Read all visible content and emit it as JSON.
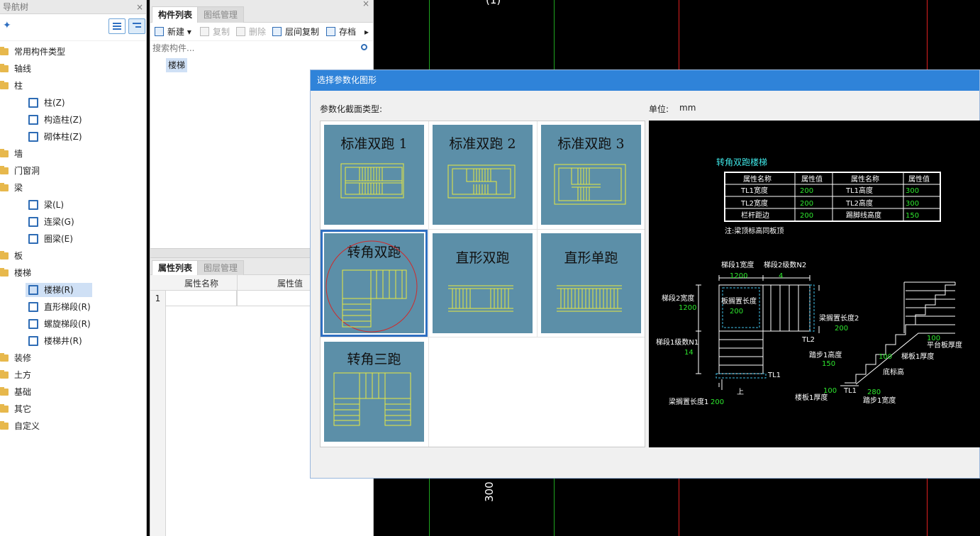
{
  "nav": {
    "title": "导航树",
    "close": "×",
    "items": [
      {
        "label": "常用构件类型",
        "level": 0
      },
      {
        "label": "轴线",
        "level": 0
      },
      {
        "label": "柱",
        "level": 0
      },
      {
        "label": "柱(Z)",
        "level": 1
      },
      {
        "label": "构造柱(Z)",
        "level": 1
      },
      {
        "label": "砌体柱(Z)",
        "level": 1
      },
      {
        "label": "墙",
        "level": 0
      },
      {
        "label": "门窗洞",
        "level": 0
      },
      {
        "label": "梁",
        "level": 0
      },
      {
        "label": "梁(L)",
        "level": 1
      },
      {
        "label": "连梁(G)",
        "level": 1
      },
      {
        "label": "圈梁(E)",
        "level": 1
      },
      {
        "label": "板",
        "level": 0
      },
      {
        "label": "楼梯",
        "level": 0
      },
      {
        "label": "楼梯(R)",
        "level": 1,
        "selected": true
      },
      {
        "label": "直形梯段(R)",
        "level": 1
      },
      {
        "label": "螺旋梯段(R)",
        "level": 1
      },
      {
        "label": "楼梯井(R)",
        "level": 1
      },
      {
        "label": "装修",
        "level": 0
      },
      {
        "label": "土方",
        "level": 0
      },
      {
        "label": "基础",
        "level": 0
      },
      {
        "label": "其它",
        "level": 0
      },
      {
        "label": "自定义",
        "level": 0
      }
    ]
  },
  "components": {
    "tab_list": "构件列表",
    "tab_drawings": "图纸管理",
    "close": "×",
    "toolbar": {
      "new": "新建",
      "copy": "复制",
      "delete": "删除",
      "floor_copy": "层间复制",
      "save": "存档",
      "more": "▸"
    },
    "search_placeholder": "搜索构件...",
    "item": "楼梯"
  },
  "properties": {
    "tab_props": "属性列表",
    "tab_layers": "图层管理",
    "col_name": "属性名称",
    "col_value": "属性值",
    "row_num": "1"
  },
  "canvas": {
    "top_label": "(1)",
    "dim_label": "300",
    "colors": {
      "green": "#1fa51f",
      "red": "#e02020",
      "white": "#ffffff"
    }
  },
  "dialog": {
    "title": "选择参数化图形",
    "section_label": "参数化截面类型:",
    "unit_label": "单位:",
    "unit_value": "mm",
    "tiles": [
      {
        "label": "标准双跑 1"
      },
      {
        "label": "标准双跑 2"
      },
      {
        "label": "标准双跑 3"
      },
      {
        "label": "转角双跑",
        "selected": true
      },
      {
        "label": "直形双跑"
      },
      {
        "label": "直形单跑"
      },
      {
        "label": "转角三跑"
      }
    ],
    "preview": {
      "title": "转角双跑楼梯",
      "table_headers": [
        "属性名称",
        "属性值",
        "属性名称",
        "属性值"
      ],
      "table_rows": [
        [
          "TL1宽度",
          "200",
          "TL1高度",
          "300"
        ],
        [
          "TL2宽度",
          "200",
          "TL2高度",
          "300"
        ],
        [
          "栏杆距边",
          "200",
          "踢脚线高度",
          "150"
        ]
      ],
      "note": "注:梁顶标高同板顶",
      "labels": {
        "seg1_width": "梯段1宽度",
        "seg1_width_val": "1200",
        "seg2_steps": "梯段2级数N2",
        "seg2_steps_val": "4",
        "seg2_width": "梯段2宽度",
        "seg2_width_val": "1200",
        "slab_len": "板搁置长度",
        "slab_len_val": "200",
        "beam_len2": "梁搁置长度2",
        "beam_len2_val": "200",
        "tl2": "TL2",
        "seg1_steps": "梯段1级数N1",
        "seg1_steps_val": "14",
        "tl1": "TL1",
        "up": "上",
        "beam_len1": "梁搁置长度1",
        "beam_len1_val": "200",
        "step1_h": "踏步1高度",
        "step1_h_val": "150",
        "slab1_thk": "梯板1厚度",
        "slab1_thk_val": "100",
        "slab1_thk2": "楼板1厚度",
        "slab1_thk2_val": "100",
        "platform_thk": "平台板厚度",
        "platform_thk_val": "100",
        "bottom_elev": "底标高",
        "tl1_b": "TL1",
        "step1_w": "踏步1宽度",
        "step1_w_val": "280"
      }
    }
  }
}
